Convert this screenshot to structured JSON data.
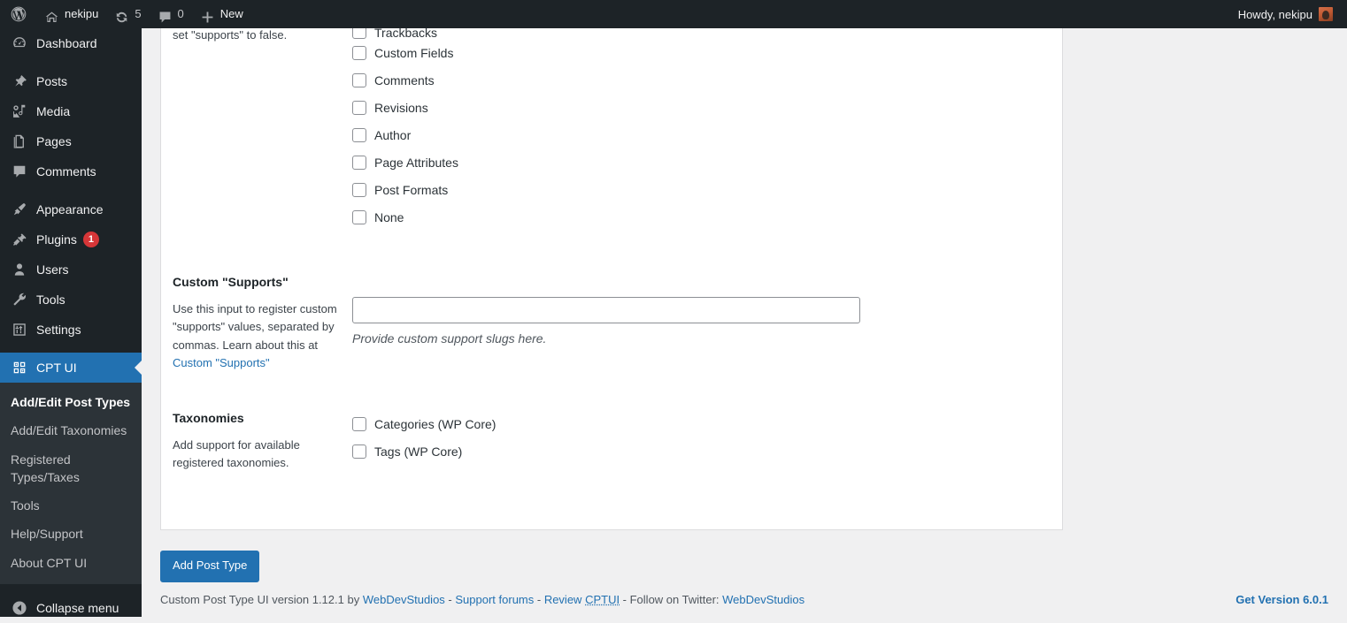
{
  "adminbar": {
    "logo_icon": "wordpress-logo-icon",
    "site_name": "nekipu",
    "site_icon": "home-icon",
    "updates_icon": "updates-icon",
    "updates_count": "5",
    "comments_icon": "comment-bubble-icon",
    "comments_count": "0",
    "new_icon": "plus-icon",
    "new_label": "New",
    "howdy": "Howdy, nekipu",
    "avatar": "user-avatar"
  },
  "sidebar": {
    "items": [
      {
        "label": "Dashboard",
        "icon": "dashboard-icon"
      },
      {
        "label": "Posts",
        "icon": "pin-icon"
      },
      {
        "label": "Media",
        "icon": "media-icon"
      },
      {
        "label": "Pages",
        "icon": "pages-icon"
      },
      {
        "label": "Comments",
        "icon": "comment-icon"
      },
      {
        "label": "Appearance",
        "icon": "paintbrush-icon"
      },
      {
        "label": "Plugins",
        "icon": "plug-icon",
        "badge": "1"
      },
      {
        "label": "Users",
        "icon": "user-icon"
      },
      {
        "label": "Tools",
        "icon": "wrench-icon"
      },
      {
        "label": "Settings",
        "icon": "settings-sliders-icon"
      },
      {
        "label": "CPT UI",
        "icon": "cptui-grid-icon",
        "current": true
      }
    ],
    "submenu": [
      {
        "label": "Add/Edit Post Types",
        "current": true
      },
      {
        "label": "Add/Edit Taxonomies"
      },
      {
        "label": "Registered Types/Taxes"
      },
      {
        "label": "Tools"
      },
      {
        "label": "Help/Support"
      },
      {
        "label": "About CPT UI"
      }
    ],
    "collapse": {
      "label": "Collapse menu",
      "icon": "chevron-left-circle-icon"
    },
    "active_color": "#2271b1",
    "badge_color": "#d63638"
  },
  "main": {
    "supports": {
      "left_text_partial": "set \"supports\" to false.",
      "checkboxes": [
        {
          "label": "Trackbacks",
          "checked": false,
          "clipped": true
        },
        {
          "label": "Custom Fields",
          "checked": false
        },
        {
          "label": "Comments",
          "checked": false
        },
        {
          "label": "Revisions",
          "checked": false
        },
        {
          "label": "Author",
          "checked": false
        },
        {
          "label": "Page Attributes",
          "checked": false
        },
        {
          "label": "Post Formats",
          "checked": false
        },
        {
          "label": "None",
          "checked": false
        }
      ]
    },
    "custom_supports": {
      "heading": "Custom \"Supports\"",
      "description_1": "Use this input to register custom \"supports\" values, separated by commas. Learn about this at ",
      "description_link": "Custom \"Supports\"",
      "input_value": "",
      "input_placeholder": "",
      "hint": "Provide custom support slugs here."
    },
    "taxonomies": {
      "heading": "Taxonomies",
      "description": "Add support for available registered taxonomies.",
      "checkboxes": [
        {
          "label": "Categories (WP Core)",
          "checked": false
        },
        {
          "label": "Tags (WP Core)",
          "checked": false
        }
      ]
    },
    "submit_label": "Add Post Type"
  },
  "footer": {
    "text_1": "Custom Post Type UI version 1.12.1 by ",
    "link_1": "WebDevStudios",
    "sep_1": " - ",
    "link_2": "Support forums",
    "sep_2": " - ",
    "review_prefix": "Review ",
    "review_abbr": "CPTUI",
    "sep_3": " - Follow on Twitter: ",
    "link_4": "WebDevStudios",
    "version_link": "Get Version 6.0.1"
  }
}
